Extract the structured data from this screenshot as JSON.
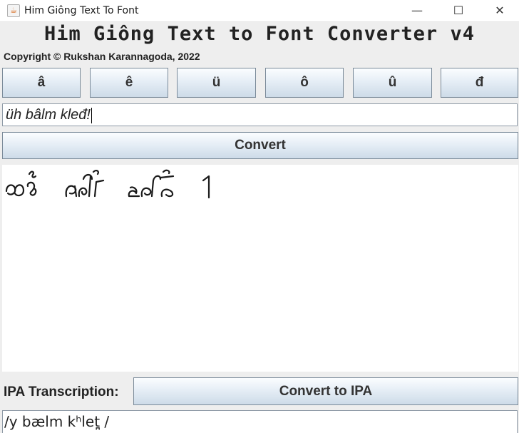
{
  "window": {
    "title": "Him Giông Text To Font",
    "app_icon": "java-cup-icon",
    "minimize_glyph": "—",
    "maximize_glyph": "☐",
    "close_glyph": "✕"
  },
  "header": {
    "title": "Him Giông Text to Font Converter v4",
    "copyright": "Copyright © Rukshan Karannagoda, 2022"
  },
  "char_buttons": [
    "â",
    "ê",
    "ü",
    "ô",
    "û",
    "đ"
  ],
  "input": {
    "value": "üh bâlm kleđ!"
  },
  "convert_label": "Convert",
  "ipa": {
    "label": "IPA Transcription:",
    "button_label": "Convert to IPA",
    "output": "/y bælm kʰlet̪ /"
  },
  "colors": {
    "button_border": "#7a8a99",
    "window_bg": "#eeeeee",
    "output_bg": "#ffffff"
  }
}
